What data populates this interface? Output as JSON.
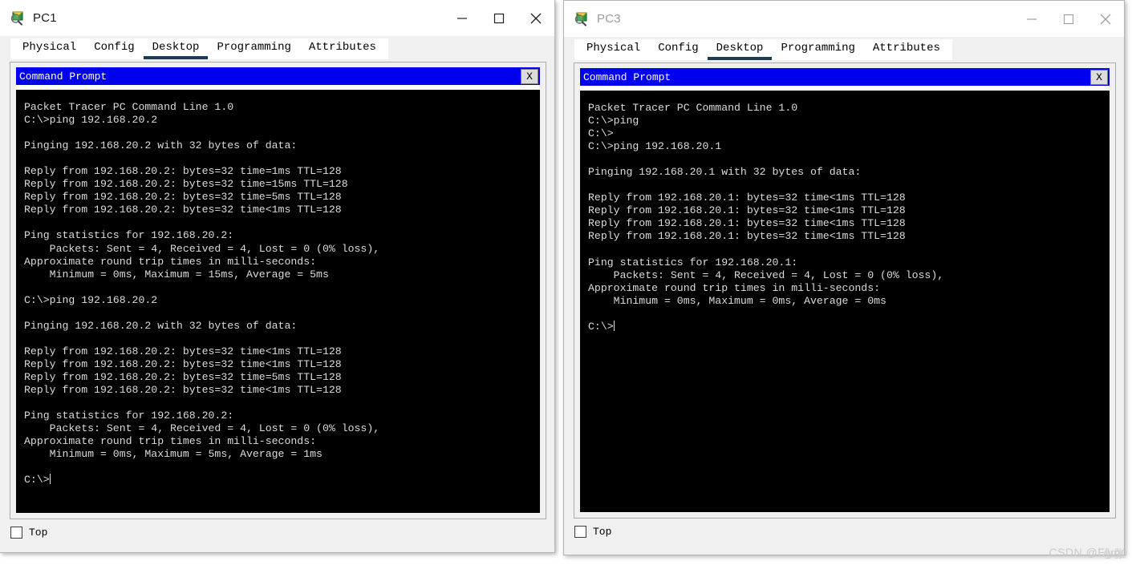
{
  "windows": [
    {
      "id": "pc1",
      "title": "PC1",
      "active": true,
      "icon": "packet-tracer-pc-icon",
      "controls": {
        "minimize": "minimize",
        "maximize": "maximize",
        "close": "close"
      },
      "tabs": [
        {
          "label": "Physical",
          "active": false
        },
        {
          "label": "Config",
          "active": false
        },
        {
          "label": "Desktop",
          "active": true
        },
        {
          "label": "Programming",
          "active": false
        },
        {
          "label": "Attributes",
          "active": false
        }
      ],
      "command_prompt": {
        "title": "Command Prompt",
        "close_label": "X",
        "console_text": "Packet Tracer PC Command Line 1.0\nC:\\>ping 192.168.20.2\n\nPinging 192.168.20.2 with 32 bytes of data:\n\nReply from 192.168.20.2: bytes=32 time=1ms TTL=128\nReply from 192.168.20.2: bytes=32 time=15ms TTL=128\nReply from 192.168.20.2: bytes=32 time=5ms TTL=128\nReply from 192.168.20.2: bytes=32 time<1ms TTL=128\n\nPing statistics for 192.168.20.2:\n    Packets: Sent = 4, Received = 4, Lost = 0 (0% loss),\nApproximate round trip times in milli-seconds:\n    Minimum = 0ms, Maximum = 15ms, Average = 5ms\n\nC:\\>ping 192.168.20.2\n\nPinging 192.168.20.2 with 32 bytes of data:\n\nReply from 192.168.20.2: bytes=32 time<1ms TTL=128\nReply from 192.168.20.2: bytes=32 time<1ms TTL=128\nReply from 192.168.20.2: bytes=32 time=5ms TTL=128\nReply from 192.168.20.2: bytes=32 time<1ms TTL=128\n\nPing statistics for 192.168.20.2:\n    Packets: Sent = 4, Received = 4, Lost = 0 (0% loss),\nApproximate round trip times in milli-seconds:\n    Minimum = 0ms, Maximum = 5ms, Average = 1ms\n\nC:\\>"
      },
      "bottom": {
        "top_label": "Top",
        "top_checked": false
      }
    },
    {
      "id": "pc3",
      "title": "PC3",
      "active": false,
      "icon": "packet-tracer-pc-icon",
      "controls": {
        "minimize": "minimize",
        "maximize": "maximize",
        "close": "close"
      },
      "tabs": [
        {
          "label": "Physical",
          "active": false
        },
        {
          "label": "Config",
          "active": false
        },
        {
          "label": "Desktop",
          "active": true
        },
        {
          "label": "Programming",
          "active": false
        },
        {
          "label": "Attributes",
          "active": false
        }
      ],
      "command_prompt": {
        "title": "Command Prompt",
        "close_label": "X",
        "console_text": "Packet Tracer PC Command Line 1.0\nC:\\>ping\nC:\\>\nC:\\>ping 192.168.20.1\n\nPinging 192.168.20.1 with 32 bytes of data:\n\nReply from 192.168.20.1: bytes=32 time<1ms TTL=128\nReply from 192.168.20.1: bytes=32 time<1ms TTL=128\nReply from 192.168.20.1: bytes=32 time<1ms TTL=128\nReply from 192.168.20.1: bytes=32 time<1ms TTL=128\n\nPing statistics for 192.168.20.1:\n    Packets: Sent = 4, Received = 4, Lost = 0 (0% loss),\nApproximate round trip times in milli-seconds:\n    Minimum = 0ms, Maximum = 0ms, Average = 0ms\n\nC:\\>"
      },
      "bottom": {
        "top_label": "Top",
        "top_checked": false
      }
    }
  ],
  "watermark": {
    "prefix": "CSDN @",
    "name_a": "Flynn",
    "name_b": "小张"
  },
  "colors": {
    "cmd_titlebar_blue": "#0000ef",
    "console_bg": "#000000",
    "console_text": "#dcdcdc",
    "active_tab_underline": "#1f3b54",
    "window_bg": "#f0f0f0"
  }
}
